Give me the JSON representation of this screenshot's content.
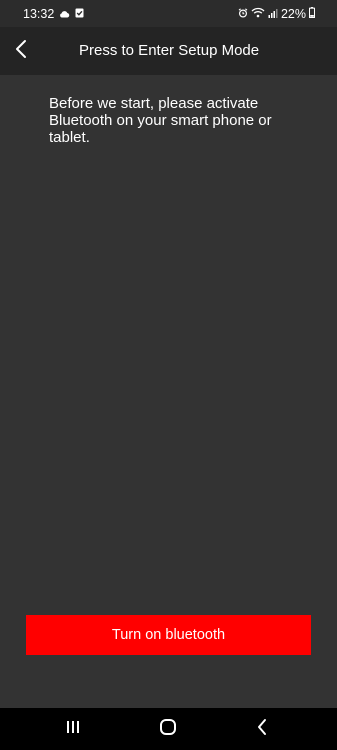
{
  "status_bar": {
    "time": "13:32",
    "battery": "22%",
    "left_icons": [
      "cloud-icon",
      "check-square-icon"
    ],
    "right_icons": [
      "alarm-icon",
      "wifi-icon",
      "signal-icon",
      "battery-icon"
    ]
  },
  "header": {
    "title": "Press to Enter Setup Mode",
    "back_icon": "chevron-left-icon"
  },
  "main": {
    "instruction": "Before we start, please activate Bluetooth on your smart phone or tablet."
  },
  "actions": {
    "primary_label": "Turn on bluetooth"
  },
  "nav_bar": {
    "icons": [
      "recents-icon",
      "home-icon",
      "back-icon"
    ]
  },
  "colors": {
    "background": "#333333",
    "app_bar": "#242424",
    "accent": "#ff0000",
    "nav_bar": "#000000"
  }
}
